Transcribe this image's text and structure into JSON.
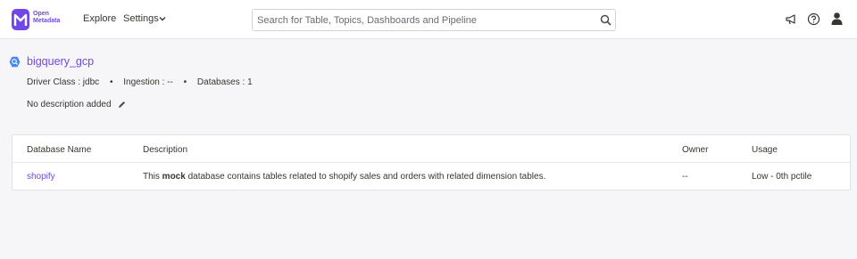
{
  "app": {
    "logo_line1": "Open",
    "logo_line2": "Metadata",
    "brand_color": "#7147e8"
  },
  "nav": {
    "explore": "Explore",
    "settings": "Settings"
  },
  "search": {
    "placeholder": "Search for Table, Topics, Dashboards and Pipeline"
  },
  "icons": [
    "announcement-icon",
    "help-icon",
    "user-avatar-icon",
    "search-icon",
    "bigquery-icon",
    "edit-icon",
    "chevron-down-icon"
  ],
  "service": {
    "name": "bigquery_gcp",
    "driver_label": "Driver Class :",
    "driver_value": "jdbc",
    "ingestion_label": "Ingestion :",
    "ingestion_value": "--",
    "databases_label": "Databases :",
    "databases_value": "1",
    "description": "No description added"
  },
  "table": {
    "headers": [
      "Database Name",
      "Description",
      "Owner",
      "Usage"
    ],
    "rows": [
      {
        "name": "shopify",
        "desc_before": "This ",
        "desc_bold": "mock",
        "desc_after": " database contains tables related to shopify sales and orders with related dimension tables.",
        "owner": "--",
        "usage": "Low - 0th pctile"
      }
    ]
  }
}
